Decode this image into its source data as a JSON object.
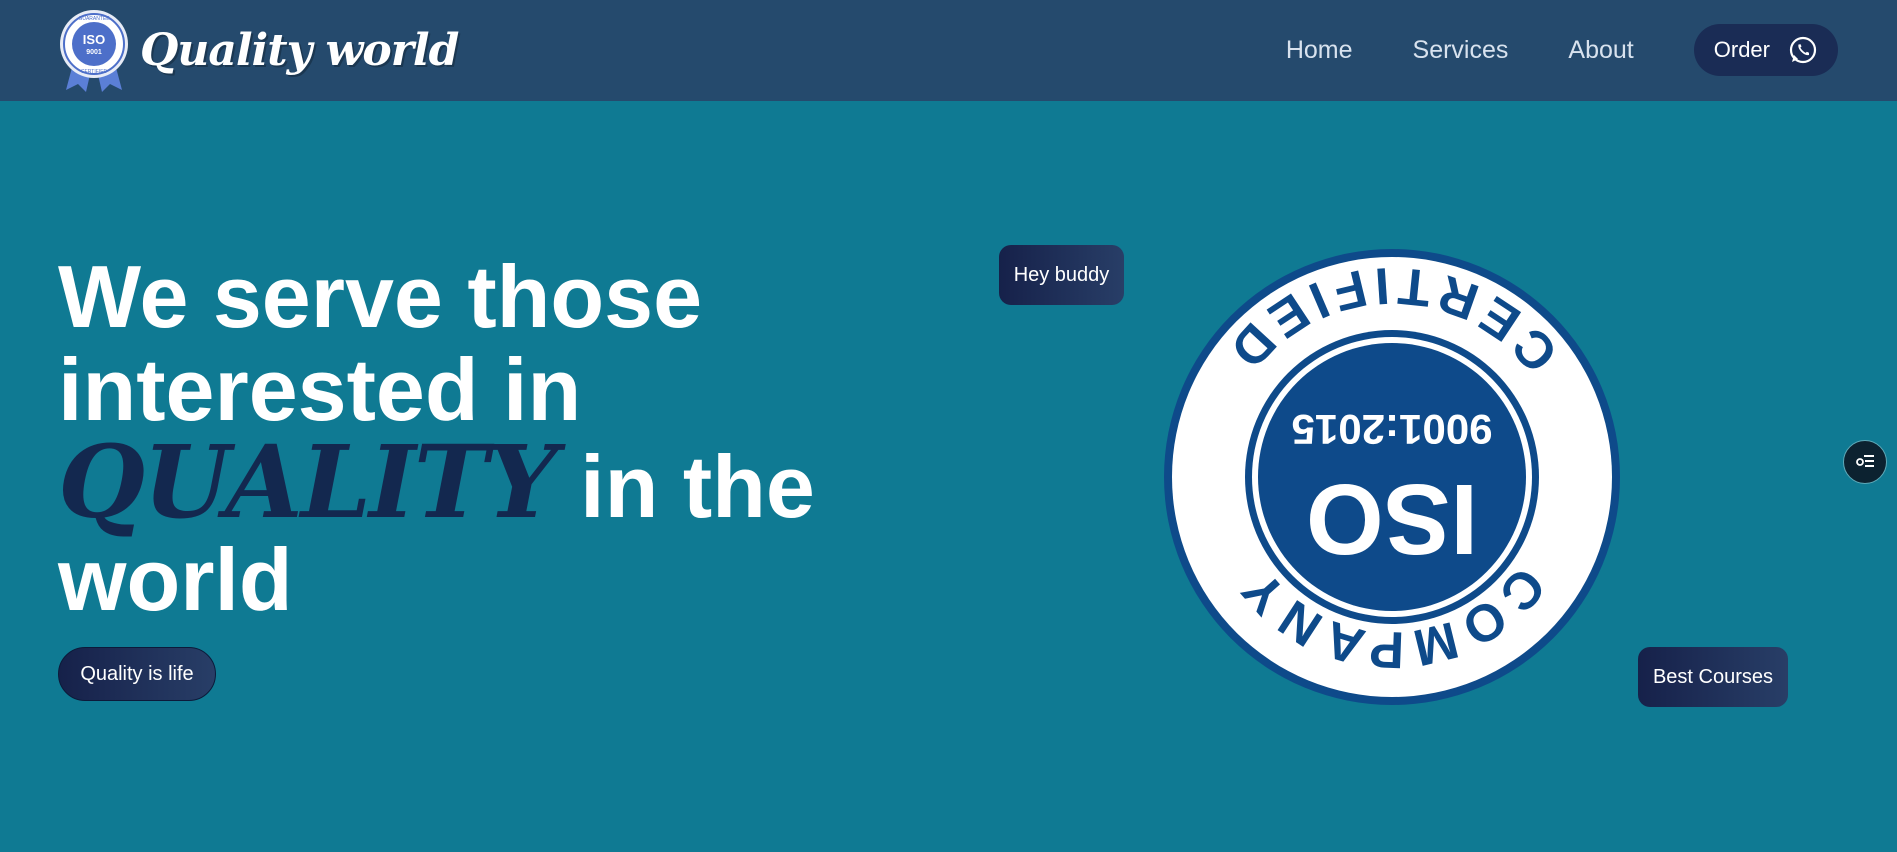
{
  "header": {
    "brand_name": "Quality world",
    "logo": {
      "top_text": "GUARANTEE",
      "center_top": "ISO",
      "center_bottom": "9001",
      "bottom_text": "CERTIFIED",
      "icon": "iso-badge-logo"
    },
    "nav": [
      {
        "label": "Home"
      },
      {
        "label": "Services"
      },
      {
        "label": "About"
      }
    ],
    "order_button": {
      "label": "Order",
      "icon": "whatsapp-icon"
    }
  },
  "hero": {
    "title_line_1": "We serve those",
    "title_line_2": "interested in",
    "title_highlight": "QUALITY",
    "title_line_3_rest": "in the",
    "title_line_4": "world",
    "cta_label": "Quality is life"
  },
  "badges": {
    "hey_buddy": "Hey buddy",
    "best_courses": "Best Courses"
  },
  "certificate_seal": {
    "ring_top": "COMPANY",
    "ring_bottom": "CERTIFIED",
    "center_number": "9001:2015",
    "center_label": "ISO",
    "orientation": "upside-down"
  },
  "floating_button": {
    "icon": "menu-list-icon"
  },
  "colors": {
    "page_bg": "#0f7a93",
    "header_bg": "#254a6d",
    "dark_navy": "#13284f",
    "seal_blue": "#0e4a8a"
  }
}
